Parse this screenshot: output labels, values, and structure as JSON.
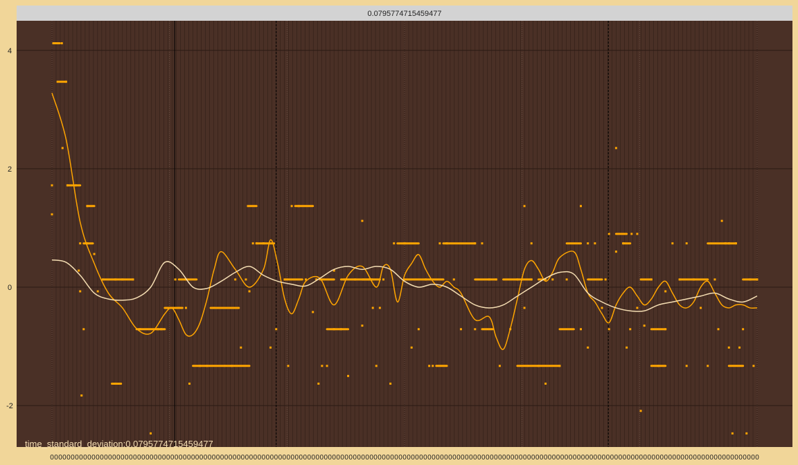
{
  "header": {
    "title": "0.0795774715459477"
  },
  "footer": {
    "annotation": "time_standard_deviation:0.0795774715459477"
  },
  "colors": {
    "frame": "#f1d699",
    "plot_bg": "#4a3026",
    "title_bar": "#d3d3d3",
    "points": "#ffa500",
    "fast_line": "#ffa500",
    "slow_line": "#f5deb3",
    "grid": "#2a1a14"
  },
  "chart_data": {
    "type": "scatter",
    "title": "0.0795774715459477",
    "annotation": "time_standard_deviation:0.0795774715459477",
    "xlim": [
      0,
      1
    ],
    "ylim": [
      -2.7,
      4.5
    ],
    "y_ticks": [
      -2,
      0,
      2,
      4
    ],
    "y_tick_labels": [
      "-2",
      "0",
      "2",
      "4"
    ],
    "grid": true,
    "vertical_markers": [
      {
        "x": 0.174,
        "style": "solid"
      },
      {
        "x": 0.318,
        "style": "dashed"
      },
      {
        "x": 0.789,
        "style": "dashed"
      }
    ],
    "points": [
      [
        0.0,
        1.72
      ],
      [
        0.0,
        1.23
      ],
      [
        0.002,
        4.12
      ],
      [
        0.008,
        4.12
      ],
      [
        0.014,
        4.12
      ],
      [
        0.008,
        3.47
      ],
      [
        0.02,
        3.47
      ],
      [
        0.015,
        2.35
      ],
      [
        0.022,
        1.72
      ],
      [
        0.034,
        1.72
      ],
      [
        0.04,
        0.74
      ],
      [
        0.05,
        1.37
      ],
      [
        0.05,
        0.74
      ],
      [
        0.06,
        0.56
      ],
      [
        0.038,
        0.28
      ],
      [
        0.04,
        -0.07
      ],
      [
        0.045,
        -0.71
      ],
      [
        0.042,
        -1.83
      ],
      [
        0.065,
        -0.07
      ],
      [
        0.072,
        0.13
      ],
      [
        0.09,
        0.13
      ],
      [
        0.1,
        0.13
      ],
      [
        0.115,
        0.13
      ],
      [
        0.09,
        -1.63
      ],
      [
        0.125,
        -0.71
      ],
      [
        0.15,
        -0.71
      ],
      [
        0.155,
        -0.71
      ],
      [
        0.14,
        -2.47
      ],
      [
        0.18,
        -0.35
      ],
      [
        0.19,
        -0.35
      ],
      [
        0.175,
        0.13
      ],
      [
        0.19,
        0.13
      ],
      [
        0.195,
        -1.63
      ],
      [
        0.21,
        -1.33
      ],
      [
        0.22,
        -1.33
      ],
      [
        0.23,
        -0.35
      ],
      [
        0.255,
        -1.33
      ],
      [
        0.26,
        0.13
      ],
      [
        0.268,
        -1.02
      ],
      [
        0.275,
        0.13
      ],
      [
        0.28,
        -0.07
      ],
      [
        0.285,
        0.74
      ],
      [
        0.278,
        1.37
      ],
      [
        0.29,
        0.74
      ],
      [
        0.3,
        0.74
      ],
      [
        0.31,
        -1.02
      ],
      [
        0.318,
        -0.71
      ],
      [
        0.33,
        0.13
      ],
      [
        0.335,
        -1.33
      ],
      [
        0.34,
        1.37
      ],
      [
        0.35,
        1.37
      ],
      [
        0.36,
        0.13
      ],
      [
        0.37,
        -0.42
      ],
      [
        0.375,
        0.13
      ],
      [
        0.378,
        -1.63
      ],
      [
        0.383,
        -1.33
      ],
      [
        0.39,
        -1.33
      ],
      [
        0.4,
        -0.71
      ],
      [
        0.41,
        -0.71
      ],
      [
        0.4,
        0.28
      ],
      [
        0.415,
        0.13
      ],
      [
        0.42,
        -1.5
      ],
      [
        0.43,
        0.13
      ],
      [
        0.44,
        1.12
      ],
      [
        0.44,
        -0.65
      ],
      [
        0.45,
        0.13
      ],
      [
        0.455,
        -0.35
      ],
      [
        0.46,
        -1.33
      ],
      [
        0.465,
        -0.35
      ],
      [
        0.47,
        0.13
      ],
      [
        0.48,
        -1.63
      ],
      [
        0.485,
        0.74
      ],
      [
        0.5,
        0.74
      ],
      [
        0.51,
        -1.02
      ],
      [
        0.52,
        -0.71
      ],
      [
        0.53,
        0.13
      ],
      [
        0.535,
        -1.33
      ],
      [
        0.54,
        -1.33
      ],
      [
        0.55,
        0.74
      ],
      [
        0.56,
        0.74
      ],
      [
        0.57,
        0.13
      ],
      [
        0.58,
        -0.71
      ],
      [
        0.6,
        -0.71
      ],
      [
        0.6,
        0.74
      ],
      [
        0.61,
        0.74
      ],
      [
        0.62,
        0.13
      ],
      [
        0.63,
        0.13
      ],
      [
        0.635,
        -1.33
      ],
      [
        0.65,
        -0.71
      ],
      [
        0.66,
        0.13
      ],
      [
        0.67,
        -0.35
      ],
      [
        0.67,
        1.37
      ],
      [
        0.68,
        0.74
      ],
      [
        0.68,
        0.13
      ],
      [
        0.69,
        -1.33
      ],
      [
        0.7,
        -1.63
      ],
      [
        0.71,
        0.13
      ],
      [
        0.72,
        -1.33
      ],
      [
        0.73,
        0.13
      ],
      [
        0.75,
        1.37
      ],
      [
        0.75,
        -0.71
      ],
      [
        0.76,
        0.74
      ],
      [
        0.76,
        -1.02
      ],
      [
        0.77,
        0.74
      ],
      [
        0.78,
        -0.35
      ],
      [
        0.785,
        0.13
      ],
      [
        0.79,
        0.9
      ],
      [
        0.79,
        -0.71
      ],
      [
        0.8,
        2.35
      ],
      [
        0.8,
        0.6
      ],
      [
        0.81,
        0.74
      ],
      [
        0.815,
        -1.02
      ],
      [
        0.82,
        -0.71
      ],
      [
        0.822,
        0.9
      ],
      [
        0.83,
        0.9
      ],
      [
        0.83,
        -0.35
      ],
      [
        0.835,
        -2.09
      ],
      [
        0.84,
        -0.65
      ],
      [
        0.85,
        0.13
      ],
      [
        0.86,
        -1.33
      ],
      [
        0.87,
        -0.07
      ],
      [
        0.87,
        -0.71
      ],
      [
        0.88,
        0.74
      ],
      [
        0.89,
        0.13
      ],
      [
        0.9,
        0.74
      ],
      [
        0.9,
        -1.33
      ],
      [
        0.91,
        0.13
      ],
      [
        0.92,
        -0.35
      ],
      [
        0.93,
        -1.33
      ],
      [
        0.94,
        0.13
      ],
      [
        0.945,
        -0.71
      ],
      [
        0.95,
        1.12
      ],
      [
        0.955,
        0.74
      ],
      [
        0.96,
        0.74
      ],
      [
        0.97,
        0.74
      ],
      [
        0.96,
        -1.02
      ],
      [
        0.965,
        -2.47
      ],
      [
        0.975,
        -1.02
      ],
      [
        0.98,
        -0.71
      ],
      [
        0.985,
        -2.47
      ],
      [
        0.99,
        0.13
      ],
      [
        0.995,
        -1.33
      ],
      [
        1.0,
        0.13
      ]
    ],
    "point_segments": [
      [
        0.002,
        0.011,
        4.12
      ],
      [
        0.01,
        0.02,
        3.47
      ],
      [
        0.022,
        0.04,
        1.72
      ],
      [
        0.05,
        0.06,
        1.37
      ],
      [
        0.045,
        0.058,
        0.74
      ],
      [
        0.072,
        0.115,
        0.13
      ],
      [
        0.085,
        0.098,
        -1.63
      ],
      [
        0.12,
        0.16,
        -0.71
      ],
      [
        0.16,
        0.185,
        -0.35
      ],
      [
        0.18,
        0.205,
        0.13
      ],
      [
        0.2,
        0.245,
        -1.33
      ],
      [
        0.225,
        0.265,
        -0.35
      ],
      [
        0.245,
        0.28,
        -1.33
      ],
      [
        0.28,
        0.29,
        1.37
      ],
      [
        0.29,
        0.315,
        0.74
      ],
      [
        0.33,
        0.355,
        0.13
      ],
      [
        0.345,
        0.37,
        1.37
      ],
      [
        0.38,
        0.4,
        0.13
      ],
      [
        0.39,
        0.42,
        -0.71
      ],
      [
        0.41,
        0.455,
        0.13
      ],
      [
        0.44,
        0.465,
        0.13
      ],
      [
        0.49,
        0.52,
        0.74
      ],
      [
        0.5,
        0.53,
        0.13
      ],
      [
        0.53,
        0.555,
        0.13
      ],
      [
        0.545,
        0.56,
        -1.33
      ],
      [
        0.555,
        0.6,
        0.74
      ],
      [
        0.6,
        0.63,
        0.13
      ],
      [
        0.61,
        0.625,
        -0.71
      ],
      [
        0.64,
        0.66,
        0.13
      ],
      [
        0.66,
        0.68,
        0.13
      ],
      [
        0.66,
        0.675,
        -1.33
      ],
      [
        0.675,
        0.72,
        -1.33
      ],
      [
        0.69,
        0.7,
        0.13
      ],
      [
        0.72,
        0.74,
        -0.71
      ],
      [
        0.73,
        0.75,
        0.74
      ],
      [
        0.76,
        0.78,
        0.13
      ],
      [
        0.81,
        0.82,
        0.74
      ],
      [
        0.8,
        0.815,
        0.9
      ],
      [
        0.835,
        0.85,
        0.13
      ],
      [
        0.85,
        0.87,
        -0.71
      ],
      [
        0.85,
        0.87,
        -1.33
      ],
      [
        0.89,
        0.93,
        0.13
      ],
      [
        0.93,
        0.97,
        0.74
      ],
      [
        0.96,
        0.98,
        -1.33
      ],
      [
        0.98,
        1.0,
        0.13
      ]
    ],
    "series": [
      {
        "style": "solid",
        "x": [
          0.0,
          0.02,
          0.04,
          0.06,
          0.08,
          0.1,
          0.12,
          0.14,
          0.16,
          0.17,
          0.18,
          0.19,
          0.2,
          0.21,
          0.22,
          0.23,
          0.24,
          0.26,
          0.28,
          0.3,
          0.31,
          0.32,
          0.33,
          0.34,
          0.35,
          0.36,
          0.38,
          0.4,
          0.42,
          0.44,
          0.46,
          0.47,
          0.48,
          0.49,
          0.5,
          0.51,
          0.52,
          0.53,
          0.54,
          0.55,
          0.56,
          0.57,
          0.58,
          0.6,
          0.62,
          0.63,
          0.64,
          0.65,
          0.66,
          0.67,
          0.68,
          0.69,
          0.7,
          0.71,
          0.72,
          0.74,
          0.75,
          0.76,
          0.77,
          0.78,
          0.79,
          0.8,
          0.81,
          0.82,
          0.83,
          0.84,
          0.85,
          0.86,
          0.87,
          0.88,
          0.89,
          0.9,
          0.91,
          0.92,
          0.93,
          0.94,
          0.95,
          0.96,
          0.97,
          0.98,
          0.99,
          1.0
        ],
        "y": [
          3.28,
          2.5,
          1.1,
          0.4,
          -0.1,
          -0.35,
          -0.7,
          -0.78,
          -0.45,
          -0.35,
          -0.55,
          -0.8,
          -0.8,
          -0.6,
          -0.2,
          0.3,
          0.6,
          0.3,
          0.0,
          0.3,
          0.8,
          0.4,
          -0.2,
          -0.45,
          -0.2,
          0.1,
          0.15,
          -0.3,
          0.2,
          0.35,
          0.0,
          0.35,
          0.3,
          -0.25,
          0.2,
          0.4,
          0.55,
          0.3,
          0.1,
          0.0,
          0.1,
          0.0,
          -0.1,
          -0.55,
          -0.5,
          -0.85,
          -1.05,
          -0.7,
          -0.2,
          0.3,
          0.45,
          0.3,
          0.1,
          0.25,
          0.5,
          0.6,
          0.3,
          -0.1,
          -0.25,
          -0.45,
          -0.6,
          -0.3,
          -0.1,
          0.0,
          -0.15,
          -0.3,
          -0.2,
          0.0,
          0.1,
          -0.1,
          -0.3,
          -0.35,
          -0.25,
          0.0,
          0.1,
          -0.1,
          -0.3,
          -0.35,
          -0.3,
          -0.3,
          -0.35,
          -0.35
        ]
      },
      {
        "style": "light",
        "x": [
          0.0,
          0.02,
          0.04,
          0.06,
          0.08,
          0.1,
          0.12,
          0.14,
          0.16,
          0.18,
          0.2,
          0.22,
          0.24,
          0.26,
          0.28,
          0.3,
          0.32,
          0.34,
          0.36,
          0.38,
          0.4,
          0.42,
          0.44,
          0.46,
          0.48,
          0.5,
          0.52,
          0.54,
          0.56,
          0.58,
          0.6,
          0.62,
          0.64,
          0.66,
          0.68,
          0.7,
          0.72,
          0.74,
          0.76,
          0.78,
          0.8,
          0.82,
          0.84,
          0.86,
          0.88,
          0.9,
          0.92,
          0.94,
          0.96,
          0.98,
          1.0
        ],
        "y": [
          0.46,
          0.42,
          0.2,
          -0.1,
          -0.2,
          -0.22,
          -0.18,
          0.0,
          0.42,
          0.3,
          0.0,
          -0.02,
          0.1,
          0.25,
          0.35,
          0.2,
          0.1,
          0.05,
          0.02,
          0.15,
          0.3,
          0.35,
          0.3,
          0.35,
          0.3,
          0.1,
          0.0,
          0.05,
          0.0,
          -0.15,
          -0.3,
          -0.35,
          -0.3,
          -0.15,
          0.0,
          0.15,
          0.25,
          0.22,
          -0.1,
          -0.25,
          -0.35,
          -0.4,
          -0.4,
          -0.3,
          -0.25,
          -0.2,
          -0.15,
          -0.1,
          -0.2,
          -0.25,
          -0.15
        ]
      }
    ]
  }
}
